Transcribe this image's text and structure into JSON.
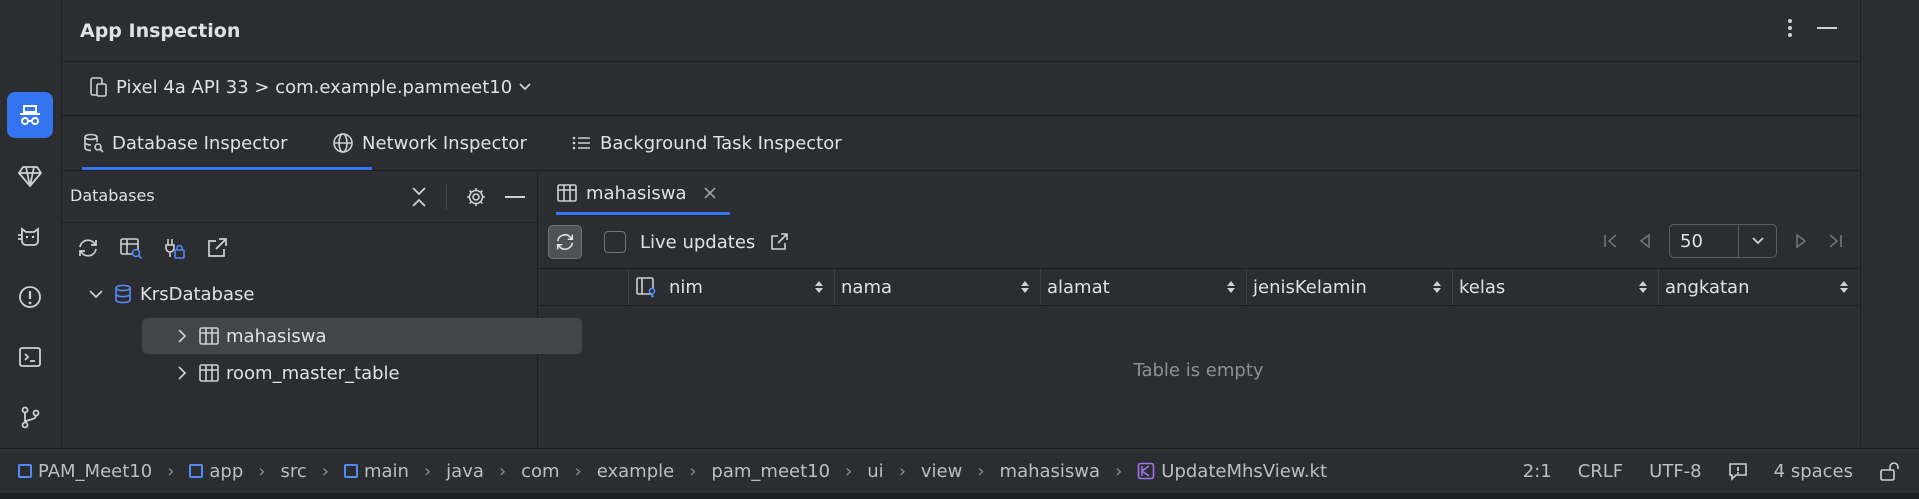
{
  "window": {
    "title": "App Inspection"
  },
  "device": {
    "label": "Pixel 4a API 33 > com.example.pammeet10"
  },
  "tabs": [
    {
      "label": "Database Inspector"
    },
    {
      "label": "Network Inspector"
    },
    {
      "label": "Background Task Inspector"
    }
  ],
  "databases": {
    "header": "Databases",
    "tree": {
      "root": "KrsDatabase",
      "children": [
        "mahasiswa",
        "room_master_table"
      ]
    }
  },
  "table_view": {
    "tab_label": "mahasiswa",
    "live_updates_label": "Live updates",
    "page_size": "50",
    "columns": [
      "nim",
      "nama",
      "alamat",
      "jenisKelamin",
      "kelas",
      "angkatan"
    ],
    "empty_text": "Table is empty"
  },
  "status": {
    "breadcrumbs": [
      "PAM_Meet10",
      "app",
      "src",
      "main",
      "java",
      "com",
      "example",
      "pam_meet10",
      "ui",
      "view",
      "mahasiswa",
      "UpdateMhsView.kt"
    ],
    "position": "2:1",
    "line_ending": "CRLF",
    "encoding": "UTF-8",
    "indent": "4 spaces"
  },
  "colors": {
    "accent": "#3574f0",
    "background": "#2b2d30",
    "divider": "#1e1f22",
    "kotlin_icon": "#a073f0"
  }
}
